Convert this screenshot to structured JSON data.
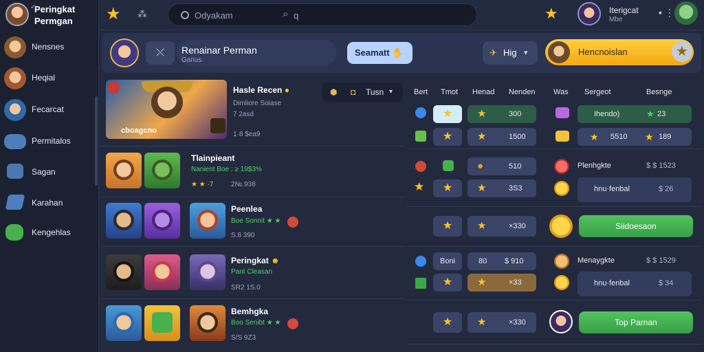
{
  "sidebar": {
    "brand": {
      "check": "✓",
      "line1": "Peringkat",
      "line2": "Permgan"
    },
    "items": [
      {
        "label": "Nensnes",
        "color": "#c98a4a"
      },
      {
        "label": "Heqial",
        "color": "#c77a4a"
      },
      {
        "label": "Fecarcat",
        "color": "#3d84c4"
      },
      {
        "label": "Permitalos",
        "color": "#4c7fb8"
      },
      {
        "label": "Sagan",
        "color": "#4c78b0"
      },
      {
        "label": "Karahan",
        "color": "#4e7dc0"
      },
      {
        "label": "Kengehlas",
        "color": "#48b04e"
      }
    ]
  },
  "topbar": {
    "grid_icon": "⁂",
    "search_placeholder": "Odyakam",
    "search_q": "q",
    "username": "Iterigcat",
    "level": "Mbe",
    "menu_dots": "▪ ⋮"
  },
  "header": {
    "swap_icon": "⤬",
    "title": "Renainar Perman",
    "subtitle": "Ganus",
    "action_button": "Seamatt",
    "action_icon": "✋",
    "select_icon": "✈",
    "select_value": "Hig",
    "select_chevron": "▾",
    "gold_label": "Hencnoislan",
    "gold_star": "★"
  },
  "games": {
    "featured": {
      "caption": "cboagcno",
      "title": "Hasle Recen",
      "title_icon": "●",
      "sub1": "Dimliore Soiase",
      "sub2": "7 2asd",
      "meta": "1·8 $ea9"
    },
    "filter": {
      "icon1": "⬢",
      "icon2": "◘",
      "label": "Tusn",
      "chevron": "▾"
    },
    "rows": [
      {
        "title": "Tlainpieant",
        "green": "Nanient Boe : ≥ 19$3%",
        "stars": "★ ★ ·7",
        "meta": "2№.938"
      },
      {
        "title": "Peenlea",
        "green": "Boe Sonnit ★ ★",
        "meta": "S.8 390"
      },
      {
        "title": "Peringkat",
        "green": "Pant Cleasan",
        "meta": "SR2 1S.0"
      },
      {
        "title": "Bemhgka",
        "green": "Boo Senibt ★ ★",
        "meta": "S/S 9Z3"
      }
    ]
  },
  "table": {
    "headers": [
      "Bert",
      "Tmot",
      "Henad",
      "Nenden",
      "Was",
      "Sergeot",
      "Besnge"
    ],
    "r1": {
      "val": "300",
      "right_a": "Ihendo)",
      "right_b": "23"
    },
    "r2": {
      "val": "1500",
      "right_a": "5510",
      "right_b": "189"
    },
    "r3": {
      "val": "510",
      "name": "Plenhgkte",
      "right": "$ $ 1523"
    },
    "r4": {
      "val": "3S3",
      "name": "hnu·fenbal",
      "right": "$ 26"
    },
    "r5": {
      "val": "×330",
      "button": "Siidoesaon"
    },
    "r6": {
      "left": "Boni",
      "val_a": "80",
      "val_b": "$ 910",
      "name": "Menaygkte",
      "right": "$ $ 1529"
    },
    "r7": {
      "val": "×33",
      "name": "hnu·fenbal",
      "right": "$ 34"
    },
    "r8": {
      "val": "×330",
      "button": "Top Parnan"
    }
  }
}
